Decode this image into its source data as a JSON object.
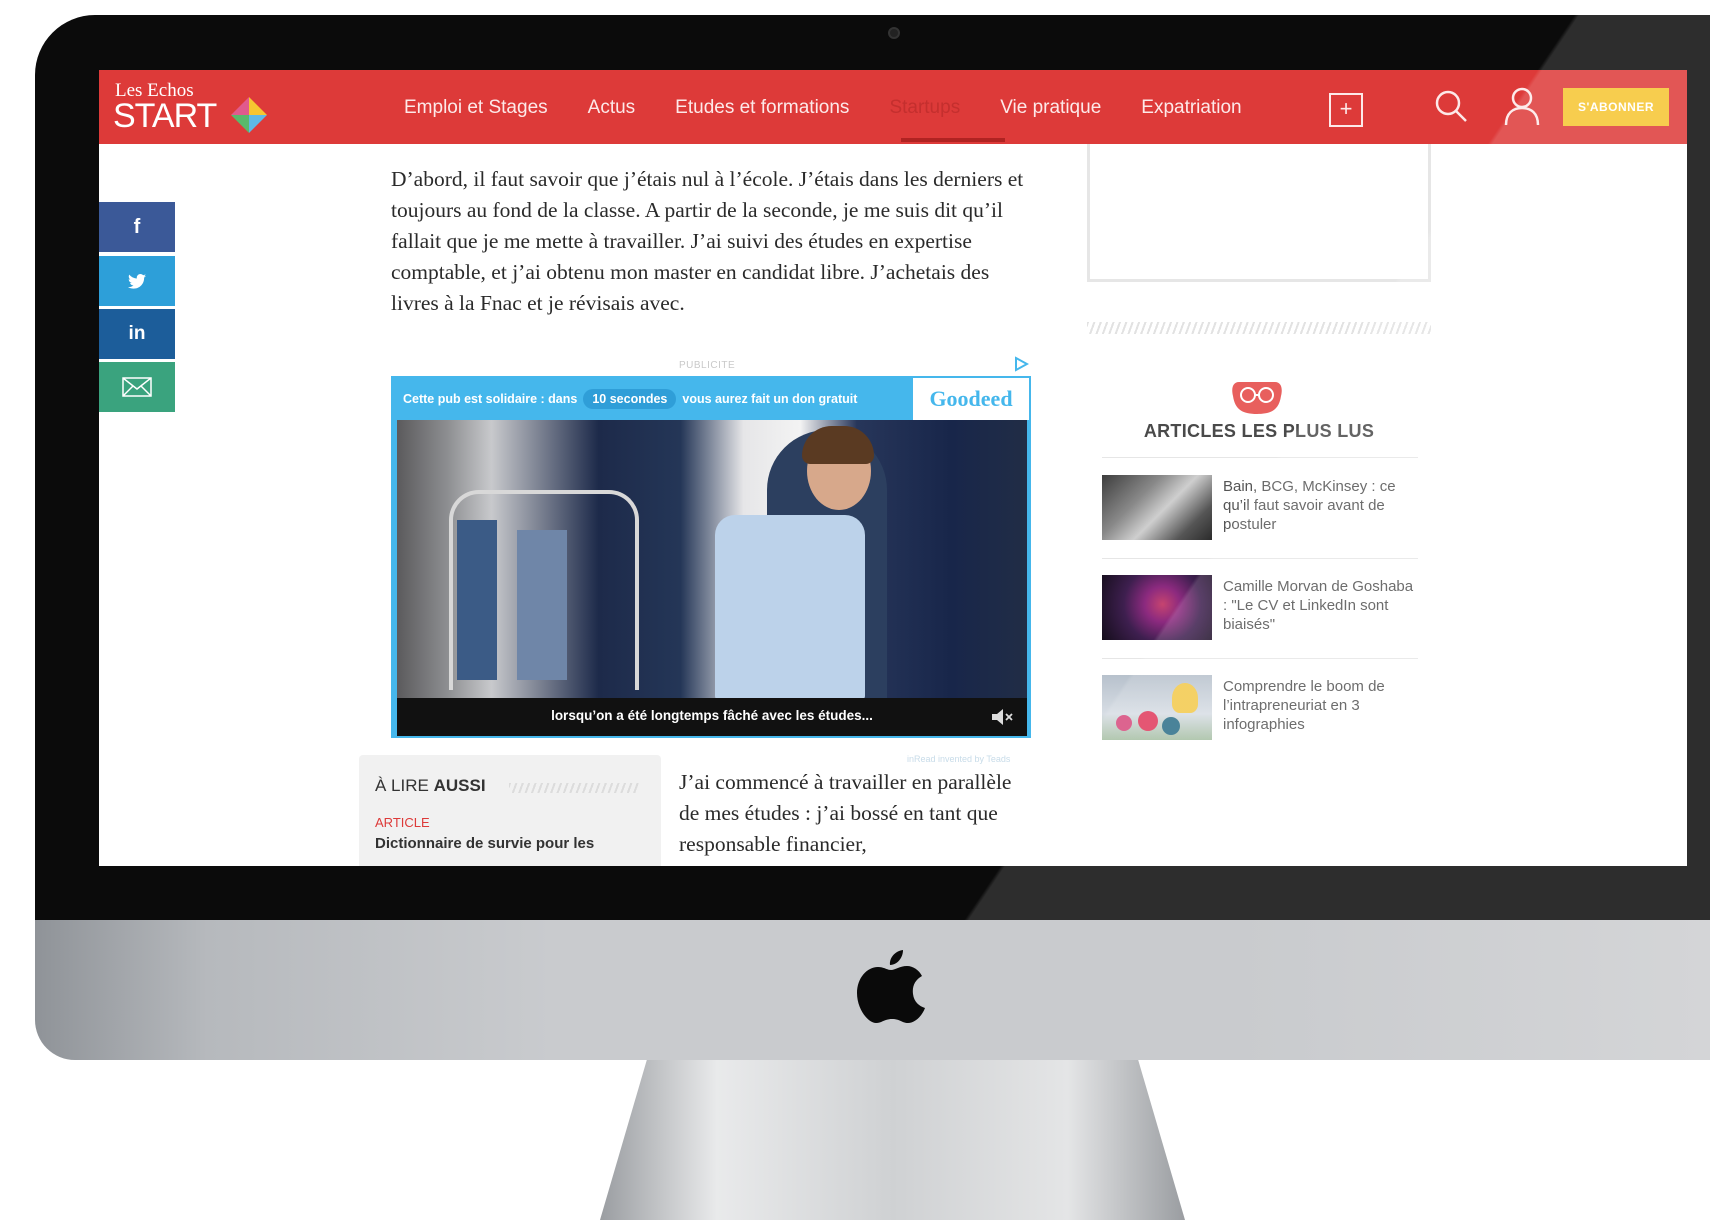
{
  "header": {
    "logo_small": "Les Echos",
    "logo_big": "START",
    "nav": [
      "Emploi et Stages",
      "Actus",
      "Etudes et formations",
      "Startups",
      "Vie pratique",
      "Expatriation"
    ],
    "active_nav": "Startups",
    "more_label": "+",
    "subscribe_label": "S'ABONNER",
    "accent_color": "#dd3a39",
    "subscribe_color": "#f6c531"
  },
  "share": {
    "facebook": "f",
    "twitter_icon": "twitter-bird-icon",
    "linkedin": "in",
    "mail_icon": "mail-icon"
  },
  "article": {
    "paragraph1": "D’abord, il faut savoir que j’étais nul à l’école. J’étais dans les derniers et toujours au fond de la classe. A partir de la seconde, je me suis dit qu’il fallait que je me mette à travailler. J’ai suivi des études en expertise comptable, et j’ai obtenu mon master en candidat libre. J’achetais des livres à la Fnac et je révisais avec.",
    "paragraph2": "J’ai commencé à travailler en parallèle de mes études : j’ai bossé en tant que responsable financier,"
  },
  "ad": {
    "label": "PUBLICITE",
    "banner_prefix": "Cette pub est solidaire : dans",
    "countdown": "10 secondes",
    "banner_suffix": "vous aurez fait un don gratuit",
    "brand": "Goodeed",
    "caption": "lorsqu’on a été longtemps fâché avec les études...",
    "credit": "inRead invented by Teads"
  },
  "read_also": {
    "title_light": "À LIRE ",
    "title_bold": "AUSSI",
    "kicker": "ARTICLE",
    "link": "Dictionnaire de survie pour les"
  },
  "sidebar": {
    "title": "ARTICLES LES PLUS LUS",
    "items": [
      {
        "text": "Bain, BCG, McKinsey : ce qu’il faut savoir avant de postuler"
      },
      {
        "text": "Camille Morvan de Goshaba : \"Le CV et LinkedIn sont biaisés\""
      },
      {
        "text": "Comprendre le boom de l’intrapreneuriat en 3 infographies"
      }
    ]
  }
}
